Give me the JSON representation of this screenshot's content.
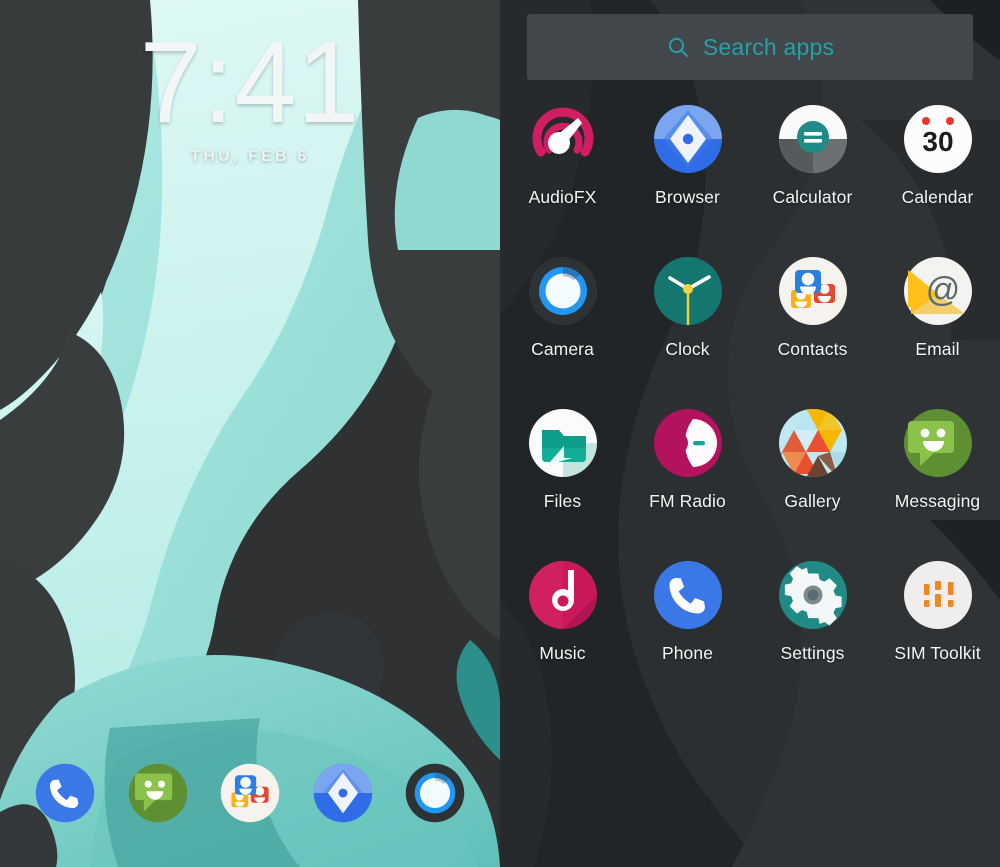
{
  "home": {
    "clock": {
      "time": "7:41",
      "date": "THU, FEB 6"
    },
    "wallpaper": {
      "name": "abstract-mint-waves",
      "colors": [
        "#9fe6e0",
        "#c9f5f0",
        "#7fd3cd",
        "#55b3ad",
        "#2f3133",
        "#3a3d3e"
      ]
    },
    "dock": [
      {
        "name": "phone",
        "label": "Phone",
        "icon": "phone-icon",
        "color": "#3b78e7"
      },
      {
        "name": "messaging",
        "label": "Messaging",
        "icon": "messaging-icon",
        "color": "#6aa84f"
      },
      {
        "name": "contacts",
        "label": "Contacts",
        "icon": "contacts-icon",
        "color": "#f5f2ee"
      },
      {
        "name": "browser",
        "label": "Browser",
        "icon": "browser-icon",
        "color": "#2f6ce5"
      },
      {
        "name": "camera",
        "label": "Camera",
        "icon": "camera-icon",
        "color": "#2f3436"
      }
    ]
  },
  "drawer": {
    "search": {
      "placeholder": "Search apps",
      "label": "Search apps",
      "icon": "search-icon",
      "color": "#27a0a5"
    },
    "background_color": "#222527",
    "apps": [
      {
        "label": "AudioFX",
        "icon": "audiofx-icon",
        "color": "#d11e62"
      },
      {
        "label": "Browser",
        "icon": "browser-icon",
        "color": "#2f6ce5"
      },
      {
        "label": "Calculator",
        "icon": "calculator-icon",
        "color": "#1f8a86"
      },
      {
        "label": "Calendar",
        "icon": "calendar-icon",
        "color": "#ffffff",
        "badge": "30"
      },
      {
        "label": "Camera",
        "icon": "camera-icon",
        "color": "#2f3436"
      },
      {
        "label": "Clock",
        "icon": "clock-icon",
        "color": "#14756f"
      },
      {
        "label": "Contacts",
        "icon": "contacts-icon",
        "color": "#f5f2ee"
      },
      {
        "label": "Email",
        "icon": "email-icon",
        "color": "#fdc11a"
      },
      {
        "label": "Files",
        "icon": "files-icon",
        "color": "#1aa08c"
      },
      {
        "label": "FM Radio",
        "icon": "fm-radio-icon",
        "color": "#b3135e"
      },
      {
        "label": "Gallery",
        "icon": "gallery-icon",
        "color": "#f5b700"
      },
      {
        "label": "Messaging",
        "icon": "messaging-icon",
        "color": "#7cb342"
      },
      {
        "label": "Music",
        "icon": "music-icon",
        "color": "#c9195b"
      },
      {
        "label": "Phone",
        "icon": "phone-icon",
        "color": "#3b78e7"
      },
      {
        "label": "Settings",
        "icon": "settings-icon",
        "color": "#1f8a86"
      },
      {
        "label": "SIM Toolkit",
        "icon": "sim-toolkit-icon",
        "color": "#f08622"
      }
    ]
  }
}
